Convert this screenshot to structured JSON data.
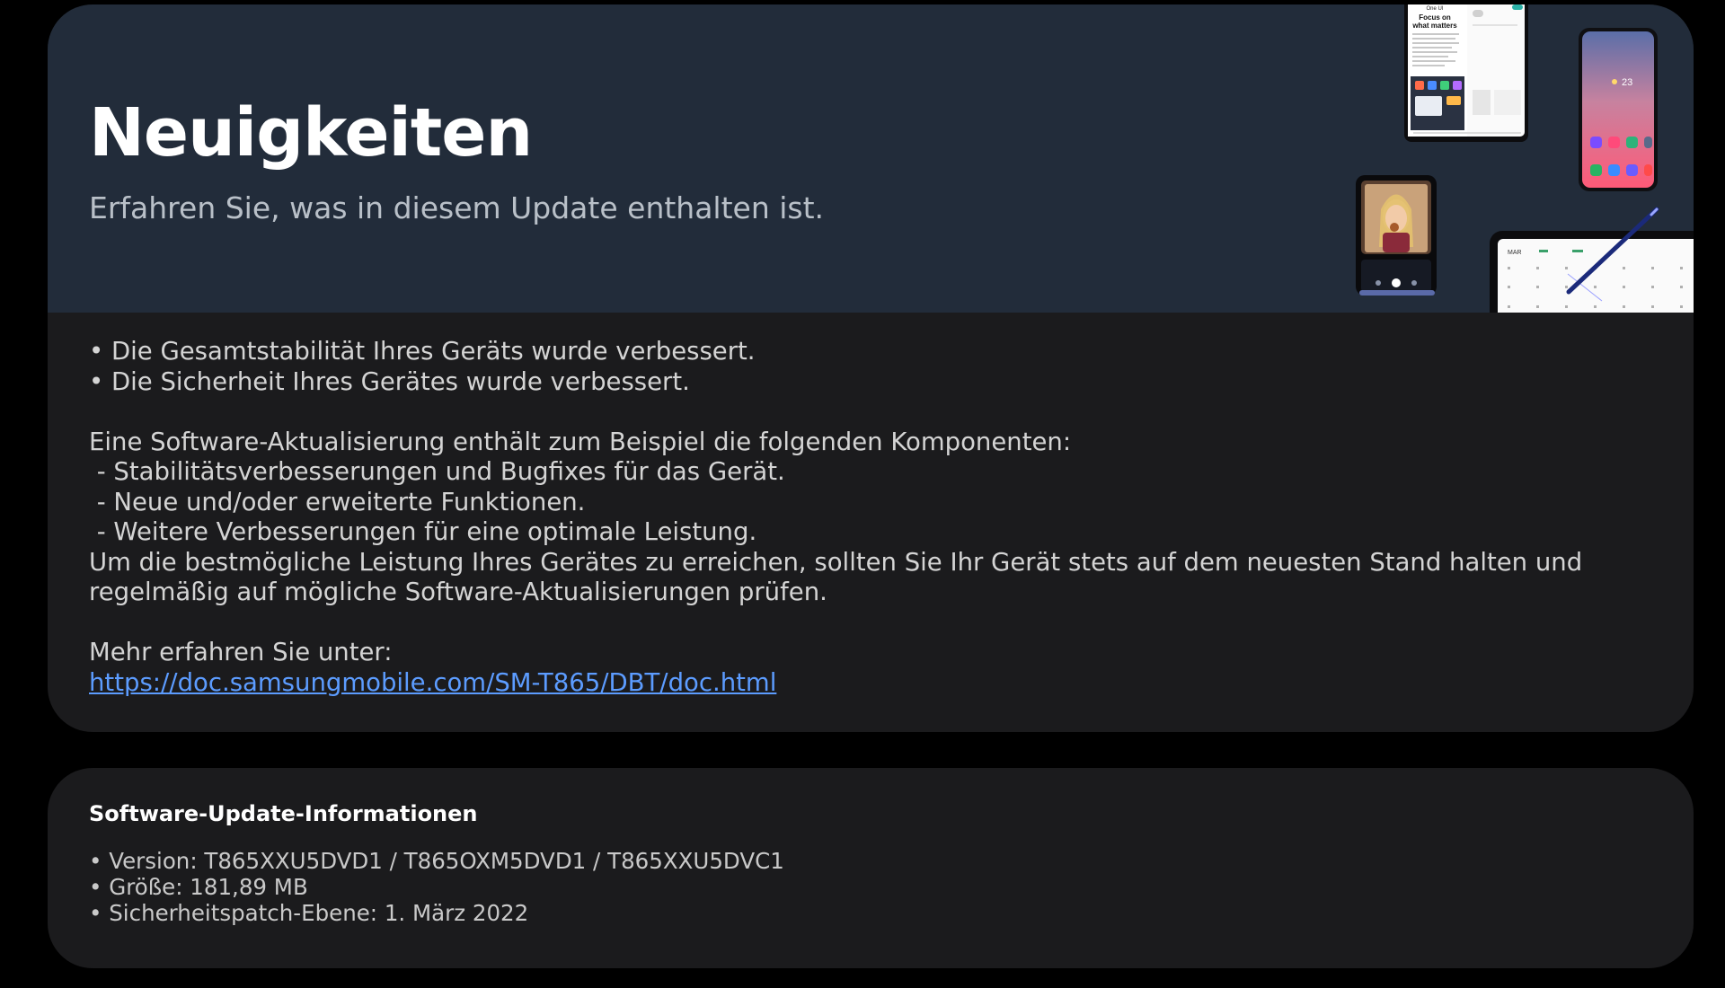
{
  "news": {
    "title": "Neuigkeiten",
    "subtitle": "Erfahren Sie, was in diesem Update enthalten ist.",
    "hero_images": {
      "tablet_top": {
        "brand": "One UI",
        "headline": "Focus on what matters"
      },
      "phone_right": {
        "weather": "23"
      },
      "calendar_tablet": {
        "month": "MAR"
      }
    },
    "bullets": [
      "• Die Gesamtstabilität Ihres Geräts wurde verbessert.",
      "• Die Sicherheit Ihres Gerätes wurde verbessert."
    ],
    "intro": "Eine Software-Aktualisierung enthält zum Beispiel die folgenden Komponenten:",
    "components": [
      " - Stabilitätsverbesserungen und Bugfixes für das Gerät.",
      " - Neue und/oder erweiterte Funktionen.",
      " - Weitere Verbesserungen für eine optimale Leistung."
    ],
    "advice": "Um die bestmögliche Leistung Ihres Gerätes zu erreichen, sollten Sie Ihr Gerät stets auf dem neuesten Stand halten und regelmäßig auf mögliche Software-Aktualisierungen prüfen.",
    "more_label": "Mehr erfahren Sie unter:",
    "link": "https://doc.samsungmobile.com/SM-T865/DBT/doc.html"
  },
  "info": {
    "title": "Software-Update-Informationen",
    "version": "• Version: T865XXU5DVD1 / T865OXM5DVD1 / T865XXU5DVC1",
    "size": "• Größe: 181,89 MB",
    "patch": "• Sicherheitspatch-Ebene: 1. März 2022"
  },
  "colors": {
    "page_bg": "#000000",
    "card_bg": "#1b1b1d",
    "hero_bg": "#222c3a",
    "link": "#5c9cff"
  }
}
